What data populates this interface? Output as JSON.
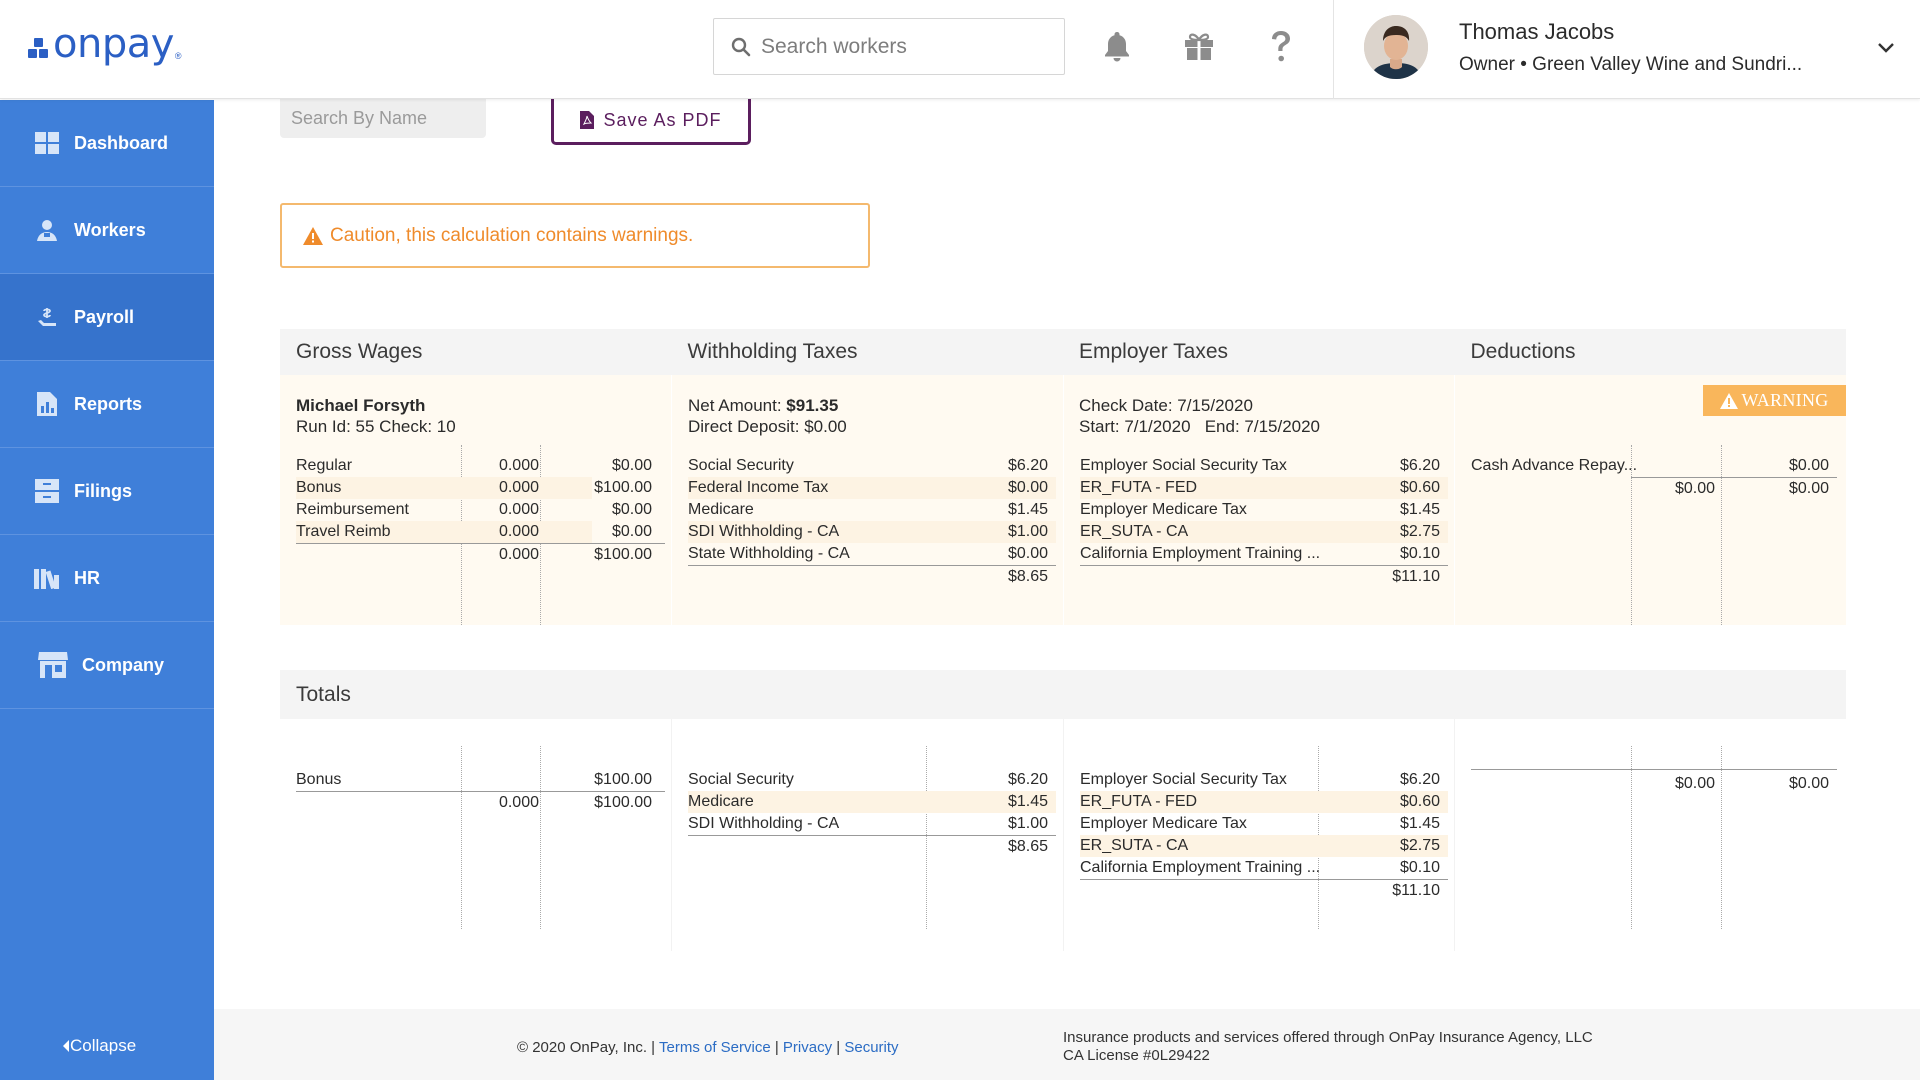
{
  "header": {
    "logo_text": "onpay",
    "logo_reg": "®",
    "search_placeholder": "Search workers",
    "icons": [
      "bell-icon",
      "gift-icon",
      "help-icon"
    ],
    "user_name": "Thomas Jacobs",
    "user_role": "Owner • Green Valley Wine and Sundri..."
  },
  "sidebar": {
    "items": [
      {
        "label": "Dashboard",
        "icon": "dashboard-icon"
      },
      {
        "label": "Workers",
        "icon": "workers-icon"
      },
      {
        "label": "Payroll",
        "icon": "payroll-icon"
      },
      {
        "label": "Reports",
        "icon": "reports-icon"
      },
      {
        "label": "Filings",
        "icon": "filings-icon"
      },
      {
        "label": "HR",
        "icon": "hr-icon"
      },
      {
        "label": "Company",
        "icon": "company-icon"
      }
    ],
    "active": "Payroll",
    "collapse_label": "Collapse"
  },
  "toolbar": {
    "name_search_placeholder": "Search By Name",
    "pdf_label": "Save As PDF"
  },
  "caution": "Caution, this calculation contains warnings.",
  "columns": {
    "gross": "Gross Wages",
    "withholding": "Withholding Taxes",
    "employer": "Employer Taxes",
    "deductions": "Deductions"
  },
  "employee": {
    "name": "Michael Forsyth",
    "run_info": "Run Id: 55 Check: 10",
    "net_label": "Net Amount: ",
    "net_value": "$91.35",
    "direct_deposit": "Direct Deposit: $0.00",
    "check_date": "Check Date: 7/15/2020",
    "period": "Start: 7/1/2020   End: 7/15/2020",
    "warning_badge": "WARNING",
    "gross": [
      {
        "label": "Regular",
        "hours": "0.000",
        "amount": "$0.00"
      },
      {
        "label": "Bonus",
        "hours": "0.000",
        "amount": "$100.00"
      },
      {
        "label": "Reimbursement",
        "hours": "0.000",
        "amount": "$0.00"
      },
      {
        "label": "Travel Reimb",
        "hours": "0.000",
        "amount": "$0.00"
      }
    ],
    "gross_total_hours": "0.000",
    "gross_total_amount": "$100.00",
    "withholding": [
      {
        "label": "Social Security",
        "amount": "$6.20"
      },
      {
        "label": "Federal Income Tax",
        "amount": "$0.00"
      },
      {
        "label": "Medicare",
        "amount": "$1.45"
      },
      {
        "label": "SDI Withholding - CA",
        "amount": "$1.00"
      },
      {
        "label": "State Withholding - CA",
        "amount": "$0.00"
      }
    ],
    "withholding_total": "$8.65",
    "employer": [
      {
        "label": "Employer Social Security Tax",
        "amount": "$6.20"
      },
      {
        "label": "ER_FUTA - FED",
        "amount": "$0.60"
      },
      {
        "label": "Employer Medicare Tax",
        "amount": "$1.45"
      },
      {
        "label": "ER_SUTA - CA",
        "amount": "$2.75"
      },
      {
        "label": "California Employment Training ...",
        "amount": "$0.10"
      }
    ],
    "employer_total": "$11.10",
    "deductions": [
      {
        "label": "Cash Advance Repay...",
        "a": "",
        "b": "$0.00"
      }
    ],
    "deductions_total_a": "$0.00",
    "deductions_total_b": "$0.00"
  },
  "totals": {
    "title": "Totals",
    "gross": [
      {
        "label": "Bonus",
        "hours": "",
        "amount": "$100.00"
      }
    ],
    "gross_total_hours": "0.000",
    "gross_total_amount": "$100.00",
    "withholding": [
      {
        "label": "Social Security",
        "amount": "$6.20"
      },
      {
        "label": "Medicare",
        "amount": "$1.45"
      },
      {
        "label": "SDI Withholding - CA",
        "amount": "$1.00"
      }
    ],
    "withholding_total": "$8.65",
    "employer": [
      {
        "label": "Employer Social Security Tax",
        "amount": "$6.20"
      },
      {
        "label": "ER_FUTA - FED",
        "amount": "$0.60"
      },
      {
        "label": "Employer Medicare Tax",
        "amount": "$1.45"
      },
      {
        "label": "ER_SUTA - CA",
        "amount": "$2.75"
      },
      {
        "label": "California Employment Training ...",
        "amount": "$0.10"
      }
    ],
    "employer_total": "$11.10",
    "deductions_total_a": "$0.00",
    "deductions_total_b": "$0.00"
  },
  "footer": {
    "copyright": "© 2020 OnPay, Inc. | ",
    "terms": "Terms of Service",
    "sep1": " | ",
    "privacy": "Privacy",
    "sep2": " | ",
    "security": "Security",
    "insurance_line1": "Insurance products and services offered through OnPay Insurance Agency, LLC",
    "insurance_line2": "CA License #0L29422"
  }
}
